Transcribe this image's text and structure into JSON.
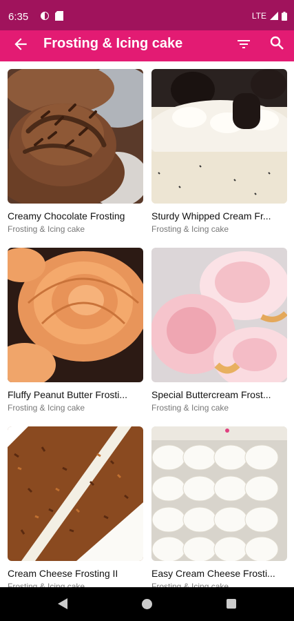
{
  "status": {
    "time": "6:35",
    "network": "LTE"
  },
  "app_bar": {
    "title": "Frosting & Icing cake"
  },
  "recipes": [
    {
      "title": "Creamy Chocolate Frosting",
      "category": "Frosting & Icing cake"
    },
    {
      "title": "Sturdy Whipped Cream Fr...",
      "category": "Frosting & Icing cake"
    },
    {
      "title": "Fluffy Peanut Butter Frosti...",
      "category": "Frosting & Icing cake"
    },
    {
      "title": "Special Buttercream Frost...",
      "category": "Frosting & Icing cake"
    },
    {
      "title": "Cream Cheese Frosting II",
      "category": "Frosting & Icing cake"
    },
    {
      "title": "Easy Cream Cheese Frosti...",
      "category": "Frosting & Icing cake"
    }
  ],
  "colors": {
    "status_bar": "#a0135c",
    "app_bar": "#e31b73"
  }
}
